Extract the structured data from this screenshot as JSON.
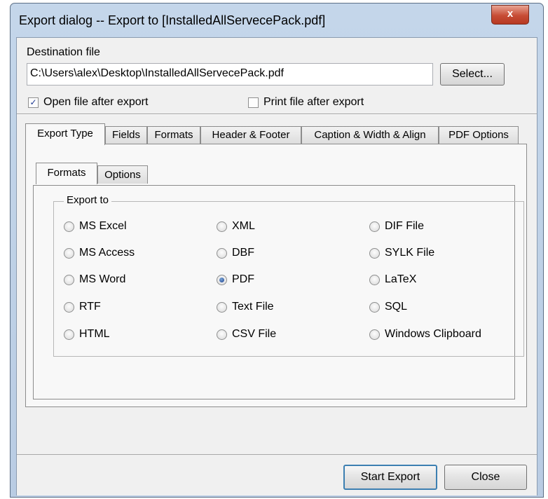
{
  "window": {
    "title": "Export dialog -- Export to [InstalledAllServecePack.pdf]",
    "close_glyph": "x"
  },
  "destination": {
    "label": "Destination file",
    "path": "C:\\Users\\alex\\Desktop\\InstalledAllServecePack.pdf",
    "select_label": "Select..."
  },
  "options": {
    "open_after_export": {
      "label": "Open file after export",
      "checked": true,
      "mark": "✓"
    },
    "print_after_export": {
      "label": "Print file after export",
      "checked": false
    }
  },
  "tabs": [
    "Export Type",
    "Fields",
    "Formats",
    "Header & Footer",
    "Caption & Width & Align",
    "PDF Options"
  ],
  "active_tab": "Export Type",
  "subtabs": [
    "Formats",
    "Options"
  ],
  "active_subtab": "Formats",
  "export_to": {
    "legend": "Export to",
    "columns": [
      [
        "MS Excel",
        "MS Access",
        "MS Word",
        "RTF",
        "HTML"
      ],
      [
        "XML",
        "DBF",
        "PDF",
        "Text File",
        "CSV File"
      ],
      [
        "DIF File",
        "SYLK File",
        "LaTeX",
        "SQL",
        "Windows Clipboard"
      ]
    ],
    "selected": "PDF"
  },
  "footer": {
    "start_export_label": "Start Export",
    "close_label": "Close"
  }
}
